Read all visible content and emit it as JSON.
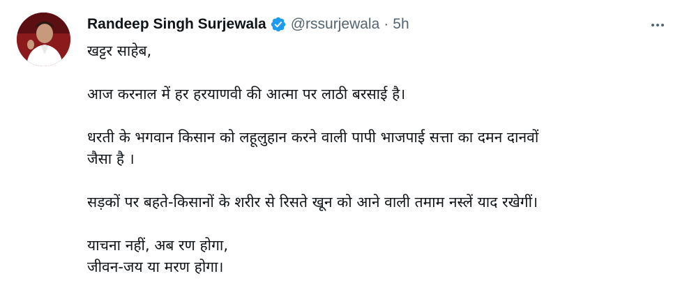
{
  "author": {
    "name": "Randeep Singh Surjewala",
    "handle": "@rssurjewala",
    "separator": "·",
    "time": "5h"
  },
  "icons": {
    "verified": "verified-badge-icon",
    "more": "more-options-icon",
    "accent": "#1d9bf0"
  },
  "tweet": {
    "line1": "खट्टर साहेब,",
    "line2": "आज करनाल में हर हरयाणवी की आत्मा पर लाठी बरसाई है।",
    "line3": "धरती के भगवान किसान को लहूलुहान करने वाली पापी भाजपाई सत्ता का दमन दानवों",
    "line4": "जैसा है ।",
    "line5": "सड़कों पर बहते-किसानों के शरीर से रिसते खून को आने वाली तमाम नस्लें याद रखेगीं।",
    "line6": "याचना नहीं, अब रण होगा,",
    "line7": "जीवन-जय या मरण होगा।"
  }
}
